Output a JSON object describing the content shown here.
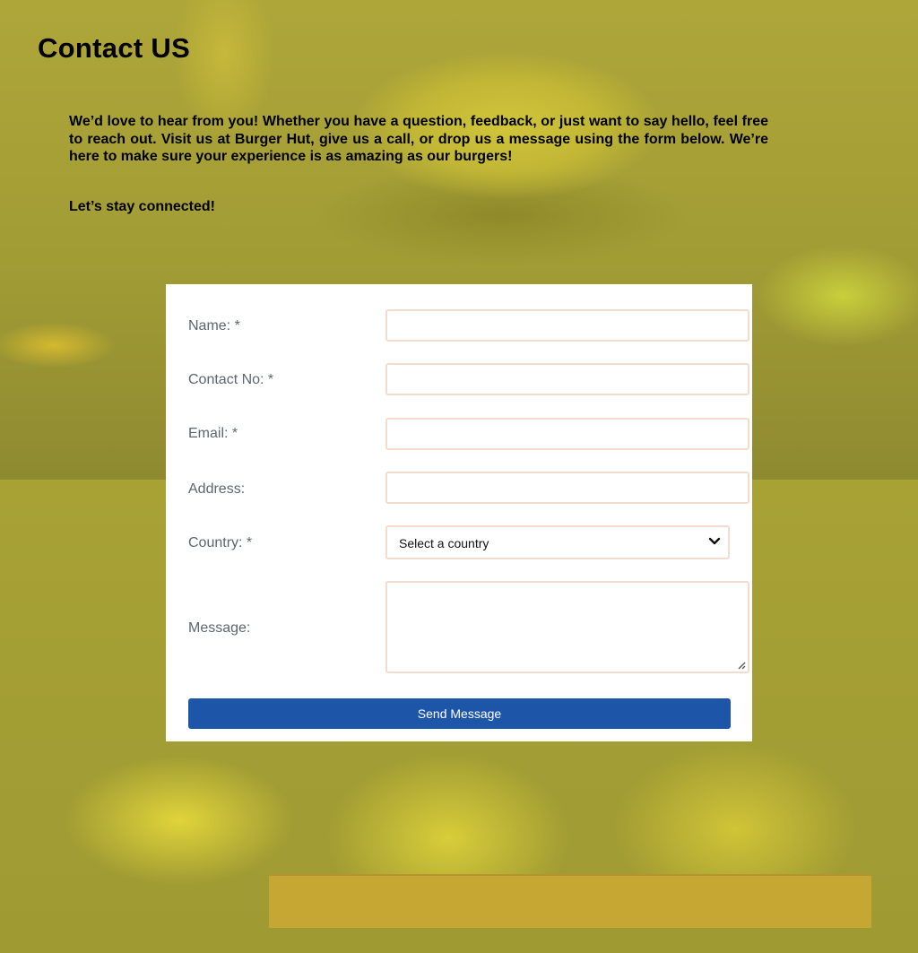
{
  "page": {
    "title": "Contact US",
    "intro_paragraph": "We’d love to hear from you! Whether you have a question, feedback, or just want to say hello, feel free to reach out. Visit us at Burger Hut, give us a call, or drop us a message using the form below. We’re here to make sure your experience is as amazing as our burgers!",
    "intro_closing": "Let’s stay connected!"
  },
  "form": {
    "name_label": "Name: *",
    "name_value": "",
    "contact_label": "Contact No: *",
    "contact_value": "",
    "email_label": "Email: *",
    "email_value": "",
    "address_label": "Address:",
    "address_value": "",
    "country_label": "Country: *",
    "country_selected": "Select a country",
    "message_label": "Message:",
    "message_value": "",
    "send_label": "Send Message"
  },
  "icons": {
    "country_dropdown": "chevron-down-icon",
    "message_resize": "resize-handle-icon"
  },
  "colors": {
    "overlay": "#a59f34",
    "button": "#1d56a9",
    "field_border": "#f3dccd",
    "label_text": "#5b6770"
  }
}
